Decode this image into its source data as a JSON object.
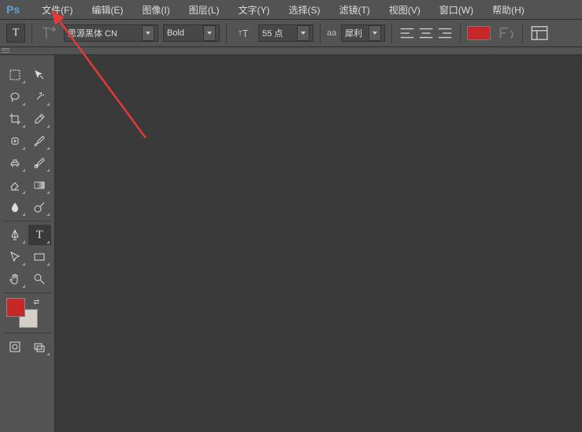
{
  "logo": "Ps",
  "menu": [
    "文件(F)",
    "编辑(E)",
    "图像(I)",
    "图层(L)",
    "文字(Y)",
    "选择(S)",
    "滤镜(T)",
    "视图(V)",
    "窗口(W)",
    "帮助(H)"
  ],
  "options": {
    "font_family": "思源黑体 CN",
    "font_style": "Bold",
    "font_size": "55 点",
    "aa_label": "aa",
    "aa_mode": "犀利"
  },
  "colors": {
    "foreground": "#c62828",
    "background": "#d4d0c8",
    "text_color": "#c62828"
  },
  "annotation_target": "文件(F)"
}
